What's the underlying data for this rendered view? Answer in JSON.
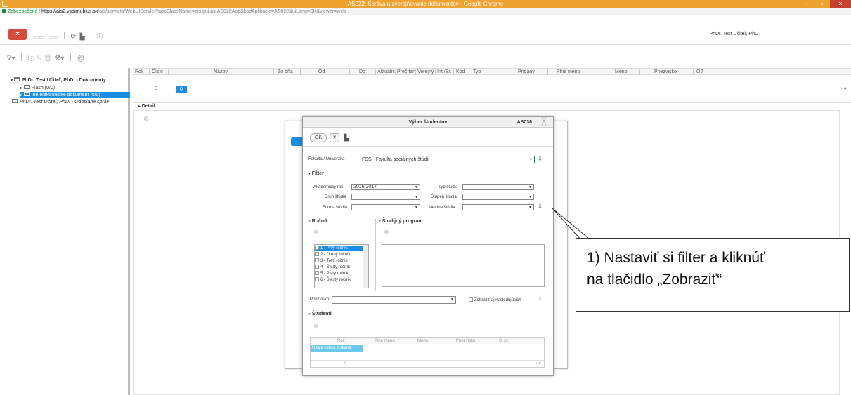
{
  "window": {
    "title": "AS022: Správa a zverejňovanie dokumentov - Google Chrome",
    "minimize": "–",
    "maximize": "▫",
    "close": "×"
  },
  "address": {
    "secure_label": "Zabezpečené",
    "host": "https://ais2.vsdanubius.sk",
    "path": "/ais/servlets/WebUIServlet?appClassName=ais.gui.as.AS022App&kodAplikacie=AS022&uiLang=SK&viewer=web"
  },
  "toolbar": {
    "close_label": "×",
    "user": "PhDr. Test Učiteľ, PhD."
  },
  "tree": {
    "root": "PhDr. Test Učiteľ, PhD. - Dokumenty",
    "items": [
      "Flash (0/0)",
      "Iné elektronické dokument (0/0)"
    ],
    "second_root": "PhDr. Test Učiteľ, PhD. - Odoslané správ"
  },
  "grid": {
    "columns": [
      "Rok",
      "Číslo",
      "Názov",
      "Zo dňa",
      "Od",
      "Do",
      "Aktuáln",
      "Prečítan",
      "Verejný",
      "Int./Ex",
      "Kód",
      "Typ",
      "Pridaný",
      "Plné meno",
      "Meno",
      "Priezvisko",
      "OJ"
    ],
    "pager_prev": "0",
    "pager_current": "0"
  },
  "detail_label": "Detail",
  "dialog": {
    "title": "Výber študentov",
    "code": "AS036",
    "ok_label": "OK",
    "faculty_label": "Fakulta / Univerzita",
    "faculty_value": "FSS - Fakulta sociálnych štúdií",
    "filter_label": "Filter",
    "academic_year_label": "Akademický rok",
    "academic_year_value": "2016/2017",
    "study_type_label": "Typ štúdia",
    "study_kind_label": "Druh štúdia",
    "study_level_label": "Stupeň štúdia",
    "study_form_label": "Forma štúdia",
    "study_method_label": "Metóda štúdia",
    "year_section": "Ročník",
    "program_section": "Študijný program",
    "years": [
      "1 - Prvý ročník",
      "2 - Druhý ročník",
      "3 - Tretí ročník",
      "4 - Štvrtý ročník",
      "5 - Piaty ročník",
      "6 - Šiesty ročník"
    ],
    "surname_label": "Priezvisko",
    "show_following_label": "Zobraziť aj nasledujúcich",
    "students_section": "Študenti",
    "students_columns": [
      "Roč",
      "Plné meno",
      "Meno",
      "Priezvisko",
      "Š. pr."
    ],
    "no_data": "Údaje neboli získané.",
    "pager_value": "0"
  },
  "callout": {
    "line1": "1) Nastaviť si filter a kliknúť",
    "line2": "na tlačidlo „Zobraziť“"
  }
}
